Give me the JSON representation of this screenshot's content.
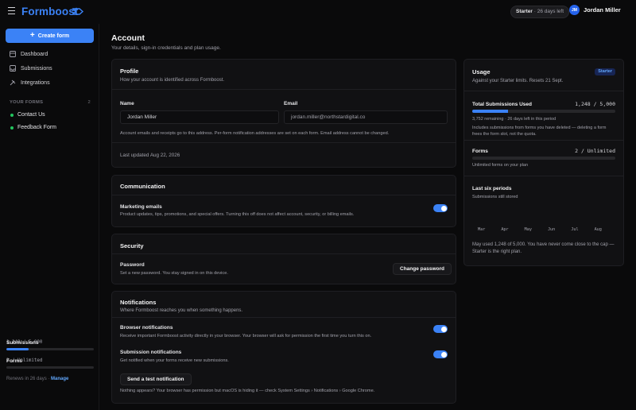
{
  "topbar": {
    "brand": "Formboost",
    "plan_name": "Starter",
    "plan_days": "· 26 days left",
    "avatar_initials": "JM",
    "user_name": "Jordan Miller"
  },
  "sidebar": {
    "create_label": "Create form",
    "nav": [
      {
        "label": "Dashboard",
        "icon": "dashboard-icon"
      },
      {
        "label": "Submissions",
        "icon": "inbox-icon"
      },
      {
        "label": "Integrations",
        "icon": "plug-icon"
      }
    ],
    "forms_heading": "YOUR FORMS",
    "forms_count": "2",
    "forms": [
      "Contact Us",
      "Feedback Form"
    ],
    "usage": {
      "submissions_label": "Submissions",
      "submissions_value": "1,248 / 5,000",
      "submissions_fraction": 0.25,
      "forms_label": "Forms",
      "forms_value": "2 / Unlimited",
      "forms_fraction": 0
    },
    "renews_text": "Renews in 26 days ·",
    "manage_label": "Manage"
  },
  "page": {
    "title": "Account",
    "subtitle": "Your details, sign-in credentials and plan usage."
  },
  "profile": {
    "title": "Profile",
    "subtitle": "How your account is identified across Formboost.",
    "name_label": "Name",
    "name_value": "Jordan Miller",
    "email_label": "Email",
    "email_value": "jordan.miller@northstardigital.co",
    "note": "Account emails and receipts go to this address. Per-form notification addresses are set on each form. Email address cannot be changed.",
    "updated": "Last updated Aug 22, 2026"
  },
  "communication": {
    "title": "Communication",
    "marketing_label": "Marketing emails",
    "marketing_desc": "Product updates, tips, promotions, and special offers. Turning this off does not affect account, security, or billing emails.",
    "marketing_on": true
  },
  "security": {
    "title": "Security",
    "password_label": "Password",
    "password_desc": "Set a new password. You stay signed in on this device.",
    "change_label": "Change password"
  },
  "notifications": {
    "title": "Notifications",
    "subtitle": "Where Formboost reaches you when something happens.",
    "browser_label": "Browser notifications",
    "browser_desc": "Receive important Formboost activity directly in your browser. Your browser will ask for permission the first time you turn this on.",
    "browser_on": true,
    "submission_label": "Submission notifications",
    "submission_desc": "Get notified when your forms receive new submissions.",
    "submission_on": true,
    "test_label": "Send a test notification",
    "help": "Nothing appears? Your browser has permission but macOS is hiding it — check System Settings › Notifications › Google Chrome."
  },
  "usage": {
    "title": "Usage",
    "badge": "Starter",
    "subtitle": "Against your Starter limits. Resets 21 Sept.",
    "total_label": "Total Submissions Used",
    "total_value": "1,248 / 5,000",
    "total_fraction": 0.25,
    "remaining": "3,752 remaining · 26 days left in this period",
    "includes": "Includes submissions from forms you have deleted — deleting a form frees the form slot, not the quota.",
    "forms_label": "Forms",
    "forms_value": "2 / Unlimited",
    "forms_fraction": 0,
    "forms_note": "Unlimited forms on your plan",
    "periods_label": "Last six periods",
    "periods_sub": "Submissions still stored",
    "months": [
      "Mar",
      "Apr",
      "May",
      "Jun",
      "Jul",
      "Aug"
    ],
    "footer": "May used 1,248 of 5,000. You have never come close to the cap — Starter is the right plan."
  },
  "colors": {
    "accent": "#3b82f6",
    "success": "#22c55e",
    "background": "#0a0a0b"
  }
}
